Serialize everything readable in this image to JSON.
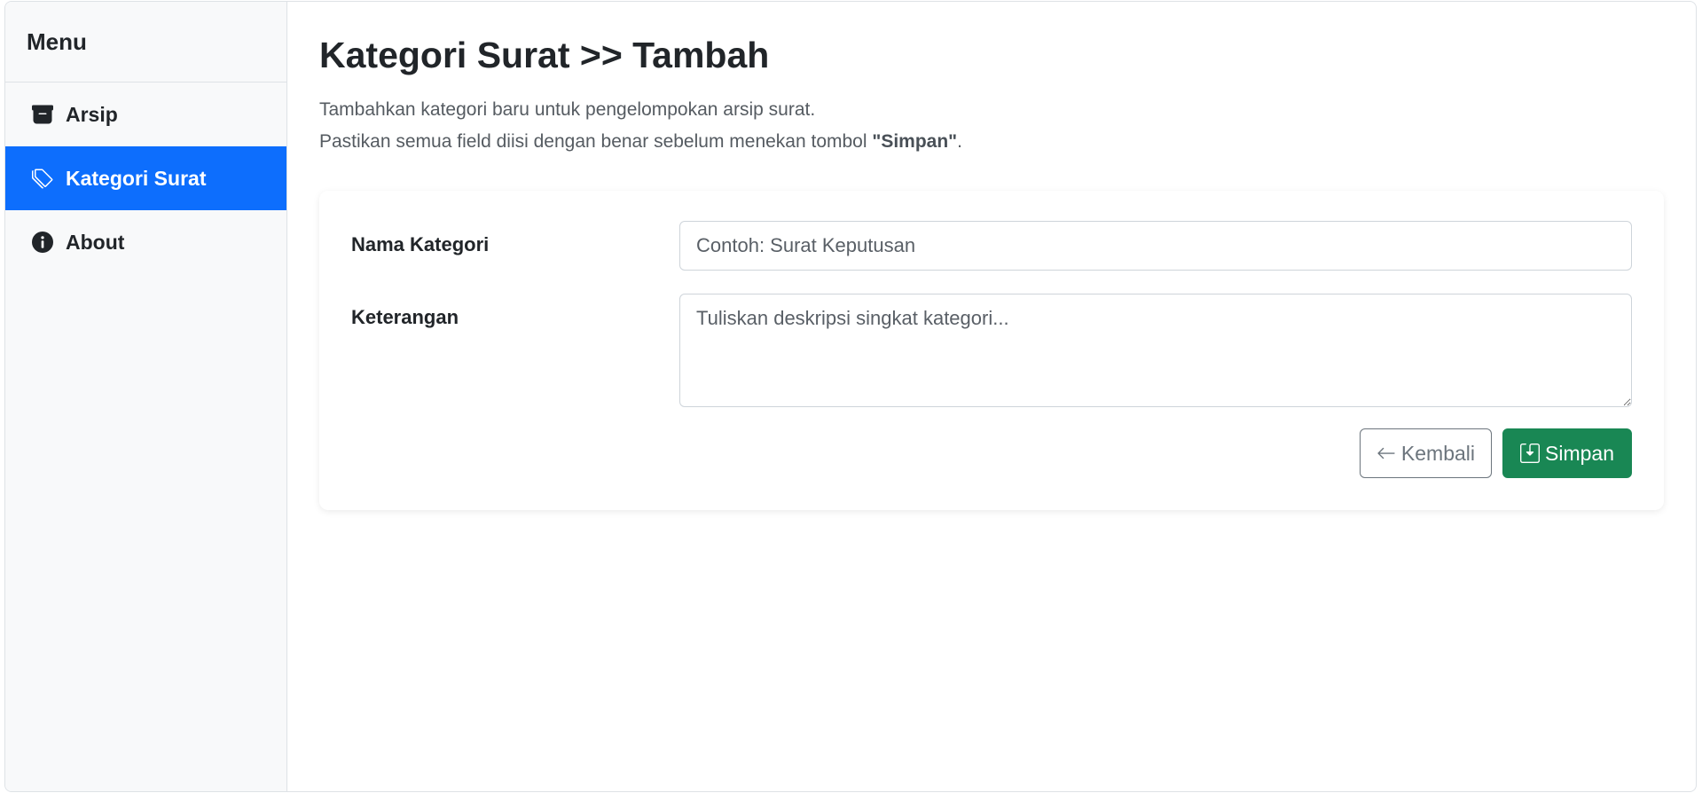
{
  "sidebar": {
    "title": "Menu",
    "items": [
      {
        "label": "Arsip",
        "icon": "archive-icon",
        "active": false
      },
      {
        "label": "Kategori Surat",
        "icon": "tags-icon",
        "active": true
      },
      {
        "label": "About",
        "icon": "info-circle-icon",
        "active": false
      }
    ]
  },
  "main": {
    "title": "Kategori Surat >> Tambah",
    "description_line1": "Tambahkan kategori baru untuk pengelompokan arsip surat.",
    "description_line2_prefix": "Pastikan semua field diisi dengan benar sebelum menekan tombol ",
    "description_line2_bold": "\"Simpan\"",
    "description_line2_suffix": "."
  },
  "form": {
    "nama_label": "Nama Kategori",
    "nama_value": "",
    "nama_placeholder": "Contoh: Surat Keputusan",
    "keterangan_label": "Keterangan",
    "keterangan_value": "",
    "keterangan_placeholder": "Tuliskan deskripsi singkat kategori...",
    "back_label": "Kembali",
    "save_label": "Simpan"
  },
  "colors": {
    "primary": "#0d6efd",
    "success": "#198754",
    "secondary": "#6c757d",
    "sidebar_bg": "#f8f9fa"
  }
}
